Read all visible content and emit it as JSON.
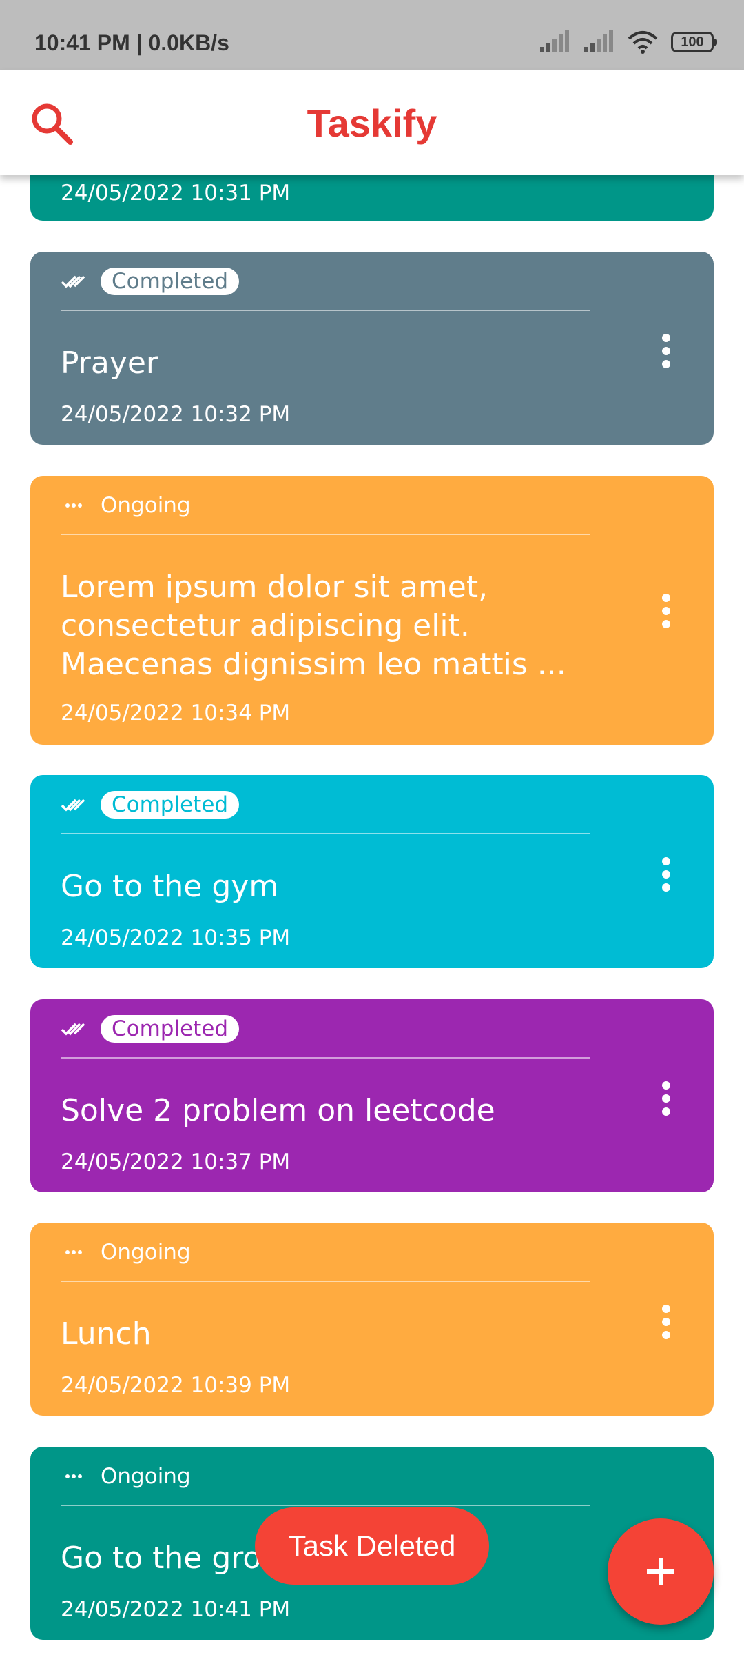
{
  "status_bar": {
    "time": "10:41 PM | 0.0KB/s",
    "battery": "100"
  },
  "app_bar": {
    "title": "Taskify",
    "search_icon": "search-icon"
  },
  "colors": {
    "accent": "#e53935",
    "teal": "#009688",
    "grey": "#607d8b",
    "orange": "#ffab40",
    "cyan": "#00bcd4",
    "purple": "#9c27b0"
  },
  "tasks": [
    {
      "status": "",
      "title": "",
      "date": "24/05/2022 10:31 PM",
      "color": "#009688"
    },
    {
      "status": "Completed",
      "title": "Prayer",
      "date": "24/05/2022 10:32 PM",
      "color": "#607d8b"
    },
    {
      "status": "Ongoing",
      "title": "Lorem ipsum dolor sit amet, consectetur adipiscing elit. Maecenas dignissim leo mattis ...",
      "date": "24/05/2022 10:34 PM",
      "color": "#ffab40"
    },
    {
      "status": "Completed",
      "title": "Go to the gym",
      "date": "24/05/2022 10:35 PM",
      "color": "#00bcd4"
    },
    {
      "status": "Completed",
      "title": "Solve 2 problem on leetcode",
      "date": "24/05/2022 10:37 PM",
      "color": "#9c27b0"
    },
    {
      "status": "Ongoing",
      "title": "Lunch",
      "date": "24/05/2022 10:39 PM",
      "color": "#ffab40"
    },
    {
      "status": "Ongoing",
      "title": "Go to the gro",
      "date": "24/05/2022 10:41 PM",
      "color": "#009688"
    }
  ],
  "snackbar": {
    "message": "Task Deleted"
  },
  "fab": {
    "icon": "plus-icon"
  }
}
